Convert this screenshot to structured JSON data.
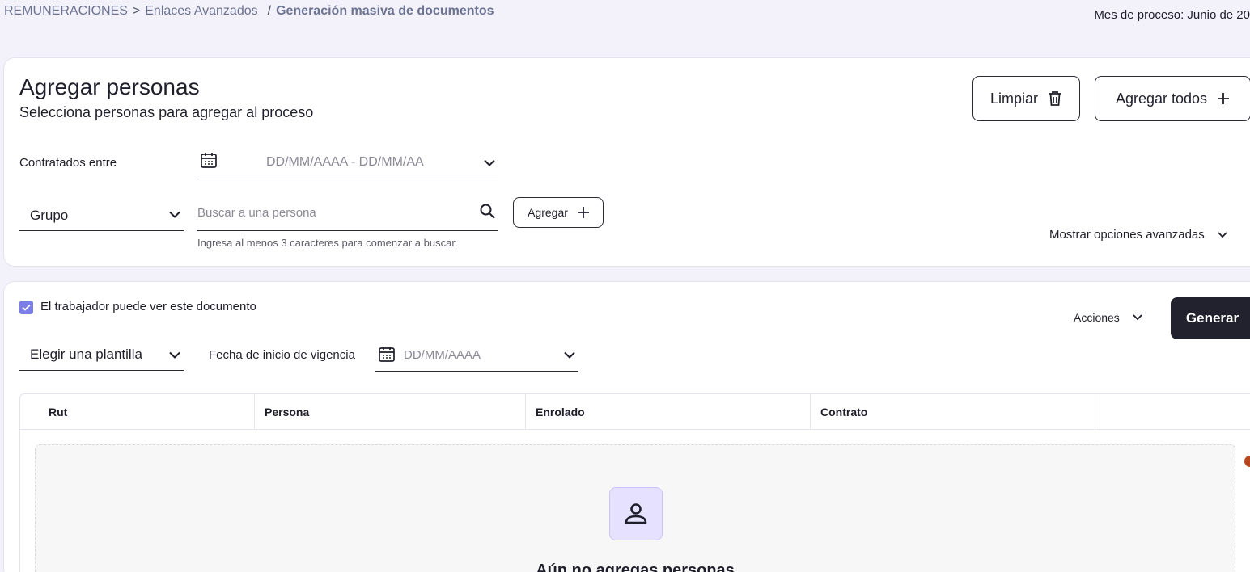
{
  "breadcrumb": {
    "root": "REMUNERACIONES",
    "sep1": ">",
    "item1": "Enlaces Avanzados",
    "sep2": "/",
    "current": "Generación masiva de documentos"
  },
  "process_month": "Mes de proceso: Junio de 20",
  "add_people": {
    "title": "Agregar personas",
    "subtitle": "Selecciona personas para agregar al proceso",
    "clear_label": "Limpiar",
    "add_all_label": "Agregar todos",
    "hired_label": "Contratados entre",
    "date_range_placeholder": "DD/MM/AAAA - DD/MM/AA",
    "group_label": "Grupo",
    "search_placeholder": "Buscar a una persona",
    "add_label": "Agregar",
    "search_hint": "Ingresa al menos 3 caracteres para comenzar a buscar.",
    "advanced_label": "Mostrar opciones avanzadas"
  },
  "generate": {
    "worker_can_see_label": "El trabajador puede ver este documento",
    "worker_can_see_checked": true,
    "actions_label": "Acciones",
    "generate_label": "Generar",
    "template_label": "Elegir una plantilla",
    "validity_label": "Fecha de inicio de vigencia",
    "validity_placeholder": "DD/MM/AAAA"
  },
  "table": {
    "columns": [
      "Rut",
      "Persona",
      "Enrolado",
      "Contrato",
      ""
    ],
    "empty_title": "Aún no agregas personas"
  },
  "colors": {
    "background": "#f3f2fa",
    "primary_dark": "#22222e",
    "accent": "#7a7ee6",
    "empty_icon_bg": "#e5e1ff"
  }
}
